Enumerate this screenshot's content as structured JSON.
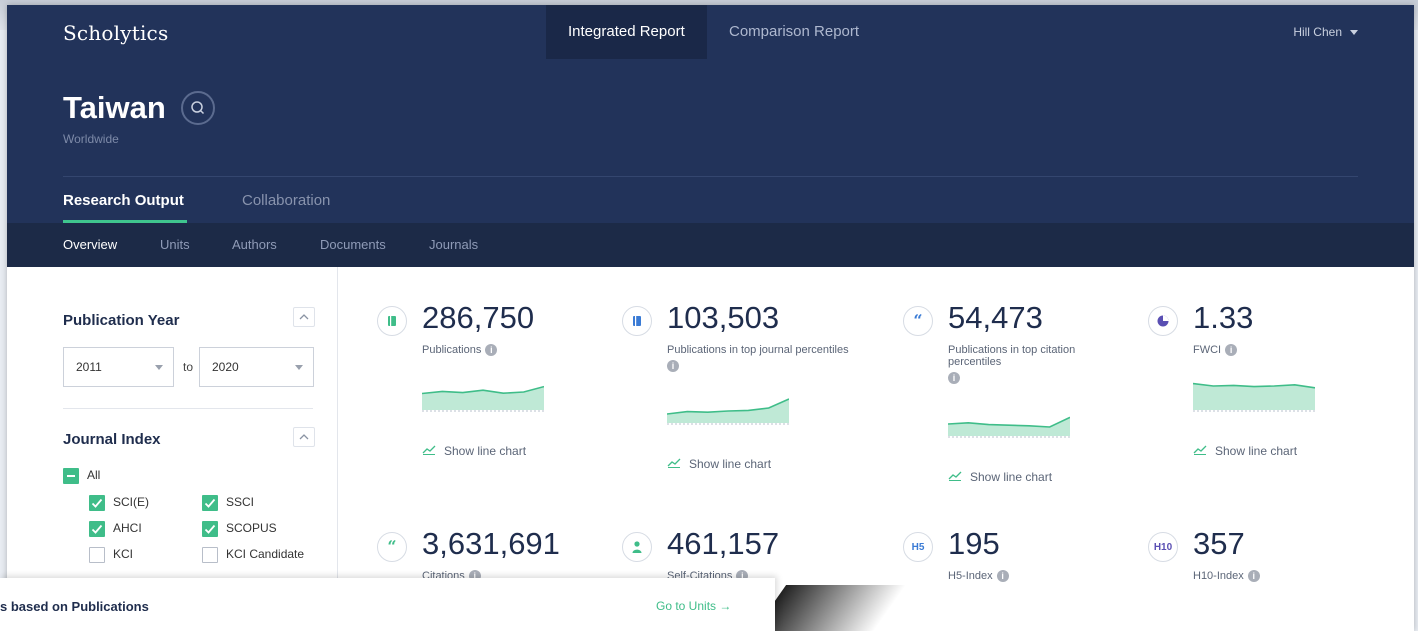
{
  "app": {
    "brand": "Scholytics",
    "user": "Hill Chen"
  },
  "topnav": {
    "tabs": [
      "Integrated Report",
      "Comparison Report"
    ],
    "active": 0
  },
  "entity": {
    "name": "Taiwan",
    "region": "Worldwide"
  },
  "section_tabs": [
    "Research Output",
    "Collaboration"
  ],
  "sub_tabs": [
    "Overview",
    "Units",
    "Authors",
    "Documents",
    "Journals"
  ],
  "filters": {
    "publication_year": {
      "title": "Publication Year",
      "from": "2011",
      "to_label": "to",
      "to": "2020"
    },
    "journal_index": {
      "title": "Journal Index",
      "all_label": "All",
      "options": [
        {
          "label": "SCI(E)",
          "checked": true
        },
        {
          "label": "SSCI",
          "checked": true
        },
        {
          "label": "AHCI",
          "checked": true
        },
        {
          "label": "SCOPUS",
          "checked": true
        },
        {
          "label": "KCI",
          "checked": false
        },
        {
          "label": "KCI Candidate",
          "checked": false
        }
      ]
    }
  },
  "metrics": [
    {
      "icon": "book-icon",
      "value": "286,750",
      "label": "Publications",
      "show_chart": "Show line chart",
      "trend": [
        0.55,
        0.62,
        0.58,
        0.66,
        0.56,
        0.6,
        0.78
      ]
    },
    {
      "icon": "book-icon",
      "value": "103,503",
      "label": "Publications in top journal percentiles",
      "show_chart": "Show line chart",
      "trend": [
        0.3,
        0.38,
        0.36,
        0.4,
        0.42,
        0.5,
        0.8
      ]
    },
    {
      "icon": "quote-icon",
      "value": "54,473",
      "label": "Publications in top citation percentiles",
      "show_chart": "Show line chart",
      "trend": [
        0.4,
        0.44,
        0.38,
        0.36,
        0.34,
        0.3,
        0.62
      ]
    },
    {
      "icon": "pie-icon",
      "value": "1.33",
      "label": "FWCI",
      "show_chart": "Show line chart",
      "trend": [
        0.88,
        0.8,
        0.82,
        0.78,
        0.8,
        0.84,
        0.74
      ]
    },
    {
      "icon": "quote-icon",
      "value": "3,631,691",
      "label": "Citations"
    },
    {
      "icon": "person-icon",
      "value": "461,157",
      "label": "Self-Citations"
    },
    {
      "icon": "h5-icon",
      "icon_text": "H5",
      "value": "195",
      "label": "H5-Index"
    },
    {
      "icon": "h10-icon",
      "icon_text": "H10",
      "value": "357",
      "label": "H10-Index"
    }
  ],
  "bottom_card": {
    "title": "s based on Publications",
    "link": "Go to Units →"
  },
  "colors": {
    "navy": "#22335a",
    "green": "#3fbd89",
    "blue": "#3a7bd5",
    "purple": "#5a4fb3"
  }
}
